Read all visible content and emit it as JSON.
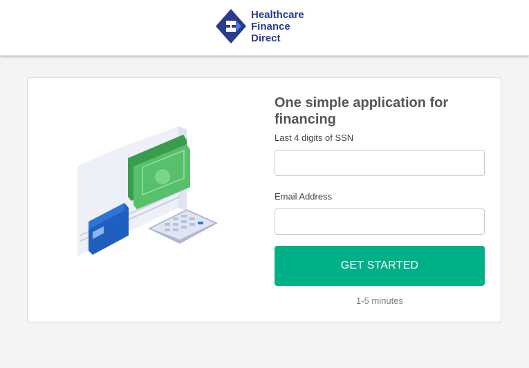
{
  "header": {
    "brand_lines": [
      "Healthcare",
      "Finance",
      "Direct"
    ],
    "brand_color": "#2a3a8c",
    "logo_icon": "hfd-logo-icon"
  },
  "main": {
    "illustration": "money-card-calculator-illustration",
    "title": "One simple application for financing",
    "ssn_label": "Last 4 digits of SSN",
    "ssn_value": "",
    "email_label": "Email Address",
    "email_value": "",
    "button_label": "GET STARTED",
    "button_color": "#00b087",
    "duration": "1-5 minutes"
  }
}
